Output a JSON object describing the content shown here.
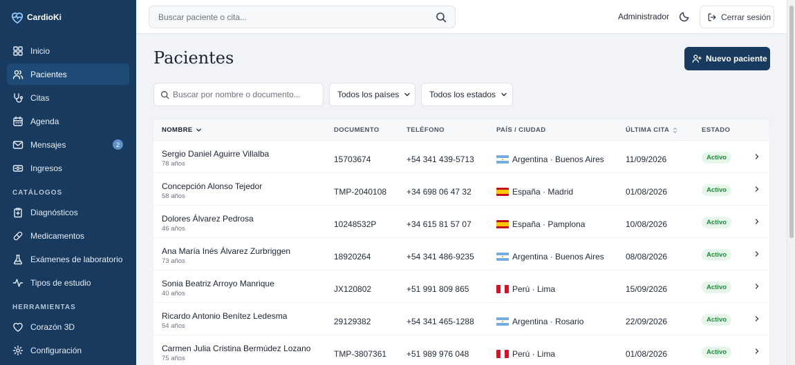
{
  "brand": {
    "name": "CardioKi"
  },
  "sidebar": {
    "items": [
      {
        "label": "Inicio",
        "icon": "grid-icon"
      },
      {
        "label": "Pacientes",
        "icon": "users-icon"
      },
      {
        "label": "Citas",
        "icon": "stethoscope-icon"
      },
      {
        "label": "Agenda",
        "icon": "calendar-icon"
      },
      {
        "label": "Mensajes",
        "icon": "mail-icon",
        "badge": "2"
      },
      {
        "label": "Ingresos",
        "icon": "banknote-icon"
      }
    ],
    "catalogos_title": "CATÁLOGOS",
    "catalogos": [
      {
        "label": "Diagnósticos",
        "icon": "clipboard-icon"
      },
      {
        "label": "Medicamentos",
        "icon": "pill-icon"
      },
      {
        "label": "Exámenes de laboratorio",
        "icon": "flask-icon"
      },
      {
        "label": "Tipos de estudio",
        "icon": "activity-icon"
      }
    ],
    "herramientas_title": "HERRAMIENTAS",
    "herramientas": [
      {
        "label": "Corazón 3D",
        "icon": "heart-icon"
      },
      {
        "label": "Configuración",
        "icon": "gear-icon"
      }
    ]
  },
  "topbar": {
    "search_placeholder": "Buscar paciente o cita...",
    "user": "Administrador",
    "logout": "Cerrar sesión"
  },
  "page": {
    "title": "Pacientes",
    "new_button": "Nuevo paciente",
    "filter_placeholder": "Buscar por nombre o documento...",
    "country_filter": "Todos los países",
    "status_filter": "Todos los estados"
  },
  "table": {
    "columns": {
      "name": "NOMBRE",
      "document": "DOCUMENTO",
      "phone": "TELÉFONO",
      "location": "PAÍS / CIUDAD",
      "last_visit": "ÚLTIMA CITA",
      "status": "ESTADO"
    },
    "rows": [
      {
        "name": "Sergio Daniel Aguirre Villalba",
        "age": "78 años",
        "document": "15703674",
        "phone": "+54 341 439-5713",
        "location": "Argentina · Buenos Aires",
        "flag": "ar",
        "last_visit": "11/09/2026",
        "status": "Activo"
      },
      {
        "name": "Concepción Alonso Tejedor",
        "age": "58 años",
        "document": "TMP-2040108",
        "phone": "+34 698 06 47 32",
        "location": "España · Madrid",
        "flag": "es",
        "last_visit": "01/08/2026",
        "status": "Activo"
      },
      {
        "name": "Dolores Álvarez Pedrosa",
        "age": "46 años",
        "document": "10248532P",
        "phone": "+34 615 81 57 07",
        "location": "España · Pamplona",
        "flag": "es",
        "last_visit": "10/08/2026",
        "status": "Activo"
      },
      {
        "name": "Ana María Inés Álvarez Zurbriggen",
        "age": "73 años",
        "document": "18920264",
        "phone": "+54 341 486-9235",
        "location": "Argentina · Buenos Aires",
        "flag": "ar",
        "last_visit": "08/08/2026",
        "status": "Activo"
      },
      {
        "name": "Sonia Beatriz Arroyo Manrique",
        "age": "40 años",
        "document": "JX120802",
        "phone": "+51 991 809 865",
        "location": "Perú · Lima",
        "flag": "pe",
        "last_visit": "15/09/2026",
        "status": "Activo"
      },
      {
        "name": "Ricardo Antonio Benítez Ledesma",
        "age": "54 años",
        "document": "29129382",
        "phone": "+54 341 465-1288",
        "location": "Argentina · Rosario",
        "flag": "ar",
        "last_visit": "22/09/2026",
        "status": "Activo"
      },
      {
        "name": "Carmen Julia Cristina Bermúdez Lozano",
        "age": "75 años",
        "document": "TMP-3807361",
        "phone": "+51 989 976 048",
        "location": "Perú · Lima",
        "flag": "pe",
        "last_visit": "01/08/2026",
        "status": "Activo"
      }
    ]
  }
}
